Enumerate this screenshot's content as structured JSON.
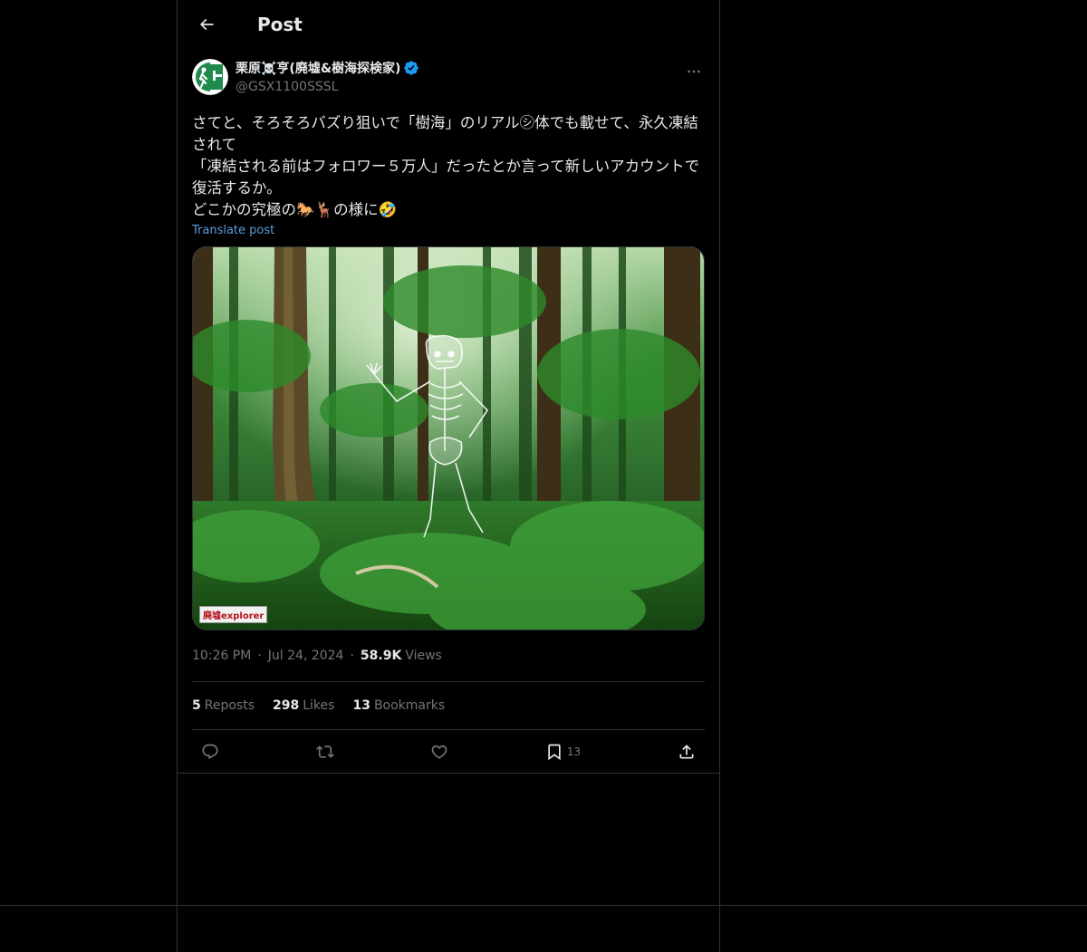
{
  "header": {
    "title": "Post",
    "back_icon": "arrow-left-icon"
  },
  "author": {
    "display_name": "栗原☠️亨(廃墟&樹海探検家)",
    "handle": "@GSX1100SSSL",
    "verified_icon": "verified-badge-icon",
    "verified_color": "#1d9bf0",
    "more_icon": "more-horizontal-icon"
  },
  "post": {
    "text": "さてと、そろそろバズり狙いで「樹海」のリアル㋛体でも載せて、永久凍結されて\n「凍結される前はフォロワー５万人」だったとか言って新しいアカウントで復活するか。\nどこかの究極の🐎🦌の様に🤣",
    "translate_label": "Translate post",
    "image_watermark": "廃墟explorer"
  },
  "meta": {
    "time": "10:26 PM",
    "date": "Jul 24, 2024",
    "views_count": "58.9K",
    "views_label": "Views"
  },
  "stats": {
    "reposts_count": "5",
    "reposts_label": "Reposts",
    "likes_count": "298",
    "likes_label": "Likes",
    "bookmarks_count": "13",
    "bookmarks_label": "Bookmarks"
  },
  "actions": {
    "reply_icon": "reply-icon",
    "repost_icon": "repost-icon",
    "like_icon": "heart-icon",
    "bookmark_icon": "bookmark-icon",
    "bookmark_count": "13",
    "share_icon": "share-icon"
  },
  "colors": {
    "background": "#000000",
    "text": "#e7e9ea",
    "muted": "#71767b",
    "link": "#1d9bf0",
    "divider": "#2f3336"
  }
}
